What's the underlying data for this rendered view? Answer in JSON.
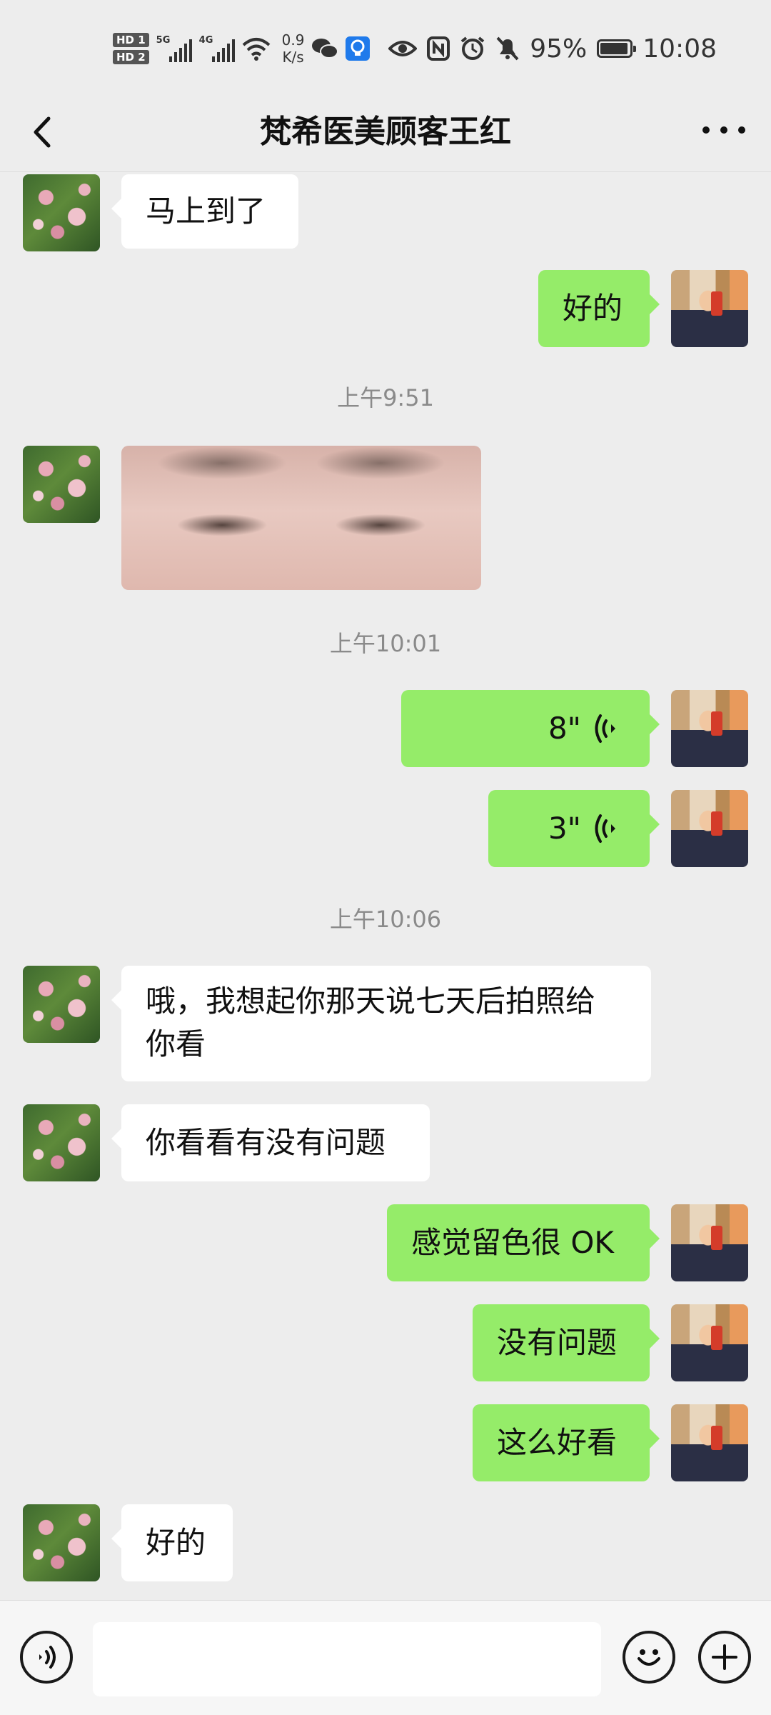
{
  "status_bar": {
    "hd1": "HD 1",
    "hd2": "HD 2",
    "sig1": "5G",
    "sig2": "4G",
    "speed_value": "0.9",
    "speed_unit": "K/s",
    "battery_percent": "95%",
    "battery_level": 0.95,
    "time": "10:08",
    "icons": [
      "wifi-icon",
      "wechat-icon",
      "bulb-icon",
      "eye-icon",
      "nfc-icon",
      "alarm-icon",
      "mute-icon",
      "battery-icon"
    ]
  },
  "header": {
    "title": "梵希医美顾客王红",
    "back_icon": "chevron-left-icon",
    "more_icon": "more-dots-icon"
  },
  "messages": [
    {
      "side": "left",
      "type": "text",
      "text": "马上到了"
    },
    {
      "side": "right",
      "type": "text",
      "text": "好的"
    },
    {
      "type": "time",
      "text": "上午9:51"
    },
    {
      "side": "left",
      "type": "image"
    },
    {
      "type": "time",
      "text": "上午10:01"
    },
    {
      "side": "right",
      "type": "voice",
      "duration": "8\""
    },
    {
      "side": "right",
      "type": "voice",
      "duration": "3\""
    },
    {
      "type": "time",
      "text": "上午10:06"
    },
    {
      "side": "left",
      "type": "text",
      "text_line1": "哦，我想起你那天说七天后拍照给",
      "text_line2": "你看"
    },
    {
      "side": "left",
      "type": "text",
      "text": "你看看有没有问题"
    },
    {
      "side": "right",
      "type": "text",
      "text": "感觉留色很 OK"
    },
    {
      "side": "right",
      "type": "text",
      "text": "没有问题"
    },
    {
      "side": "right",
      "type": "text",
      "text": "这么好看"
    },
    {
      "side": "left",
      "type": "text",
      "text": "好的"
    }
  ],
  "input_bar": {
    "voice_icon": "voice-mode-icon",
    "emoji_icon": "emoji-icon",
    "plus_icon": "plus-icon",
    "value": ""
  },
  "colors": {
    "background": "#ededed",
    "bubble_green": "#95ec69",
    "bubble_white": "#ffffff",
    "timestamp": "#8a8a8a"
  }
}
